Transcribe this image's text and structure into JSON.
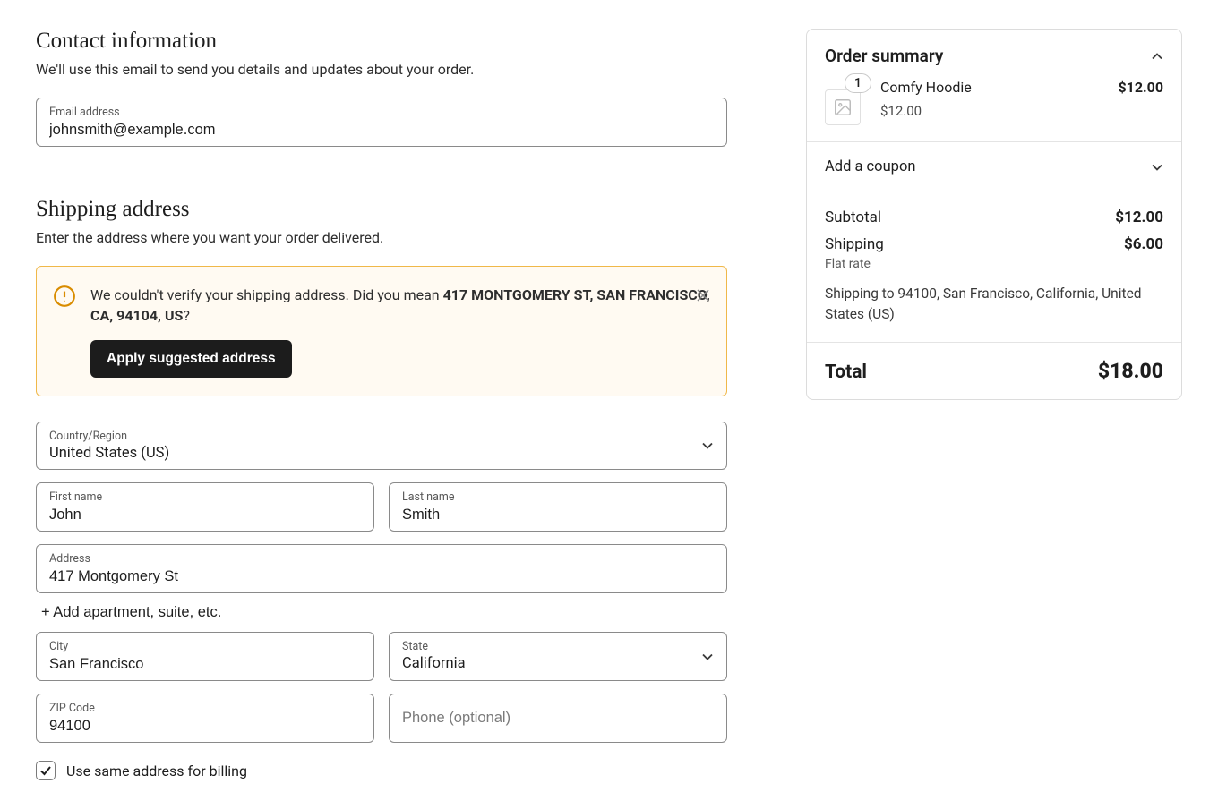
{
  "contact": {
    "title": "Contact information",
    "subtitle": "We'll use this email to send you details and updates about your order.",
    "email_label": "Email address",
    "email_value": "johnsmith@example.com"
  },
  "shipping": {
    "title": "Shipping address",
    "subtitle": "Enter the address where you want your order delivered.",
    "alert": {
      "prefix": "We couldn't verify your shipping address. Did you mean ",
      "suggested": "417 MONTGOMERY ST, SAN FRANCISCO, CA, 94104, US",
      "suffix": "?",
      "apply_label": "Apply suggested address"
    },
    "country_label": "Country/Region",
    "country_value": "United States (US)",
    "first_name_label": "First name",
    "first_name_value": "John",
    "last_name_label": "Last name",
    "last_name_value": "Smith",
    "address_label": "Address",
    "address_value": "417 Montgomery St",
    "add_apt_label": "+ Add apartment, suite, etc.",
    "city_label": "City",
    "city_value": "San Francisco",
    "state_label": "State",
    "state_value": "California",
    "zip_label": "ZIP Code",
    "zip_value": "94100",
    "phone_placeholder": "Phone (optional)",
    "phone_value": "",
    "same_billing_label": "Use same address for billing"
  },
  "summary": {
    "title": "Order summary",
    "item": {
      "qty": "1",
      "name": "Comfy Hoodie",
      "line_total": "$12.00",
      "unit_price": "$12.00"
    },
    "coupon_label": "Add a coupon",
    "subtotal_label": "Subtotal",
    "subtotal_value": "$12.00",
    "shipping_label": "Shipping",
    "shipping_value": "$6.00",
    "shipping_method": "Flat rate",
    "ship_to": "Shipping to 94100, San Francisco, California, United States (US)",
    "total_label": "Total",
    "total_value": "$18.00"
  }
}
